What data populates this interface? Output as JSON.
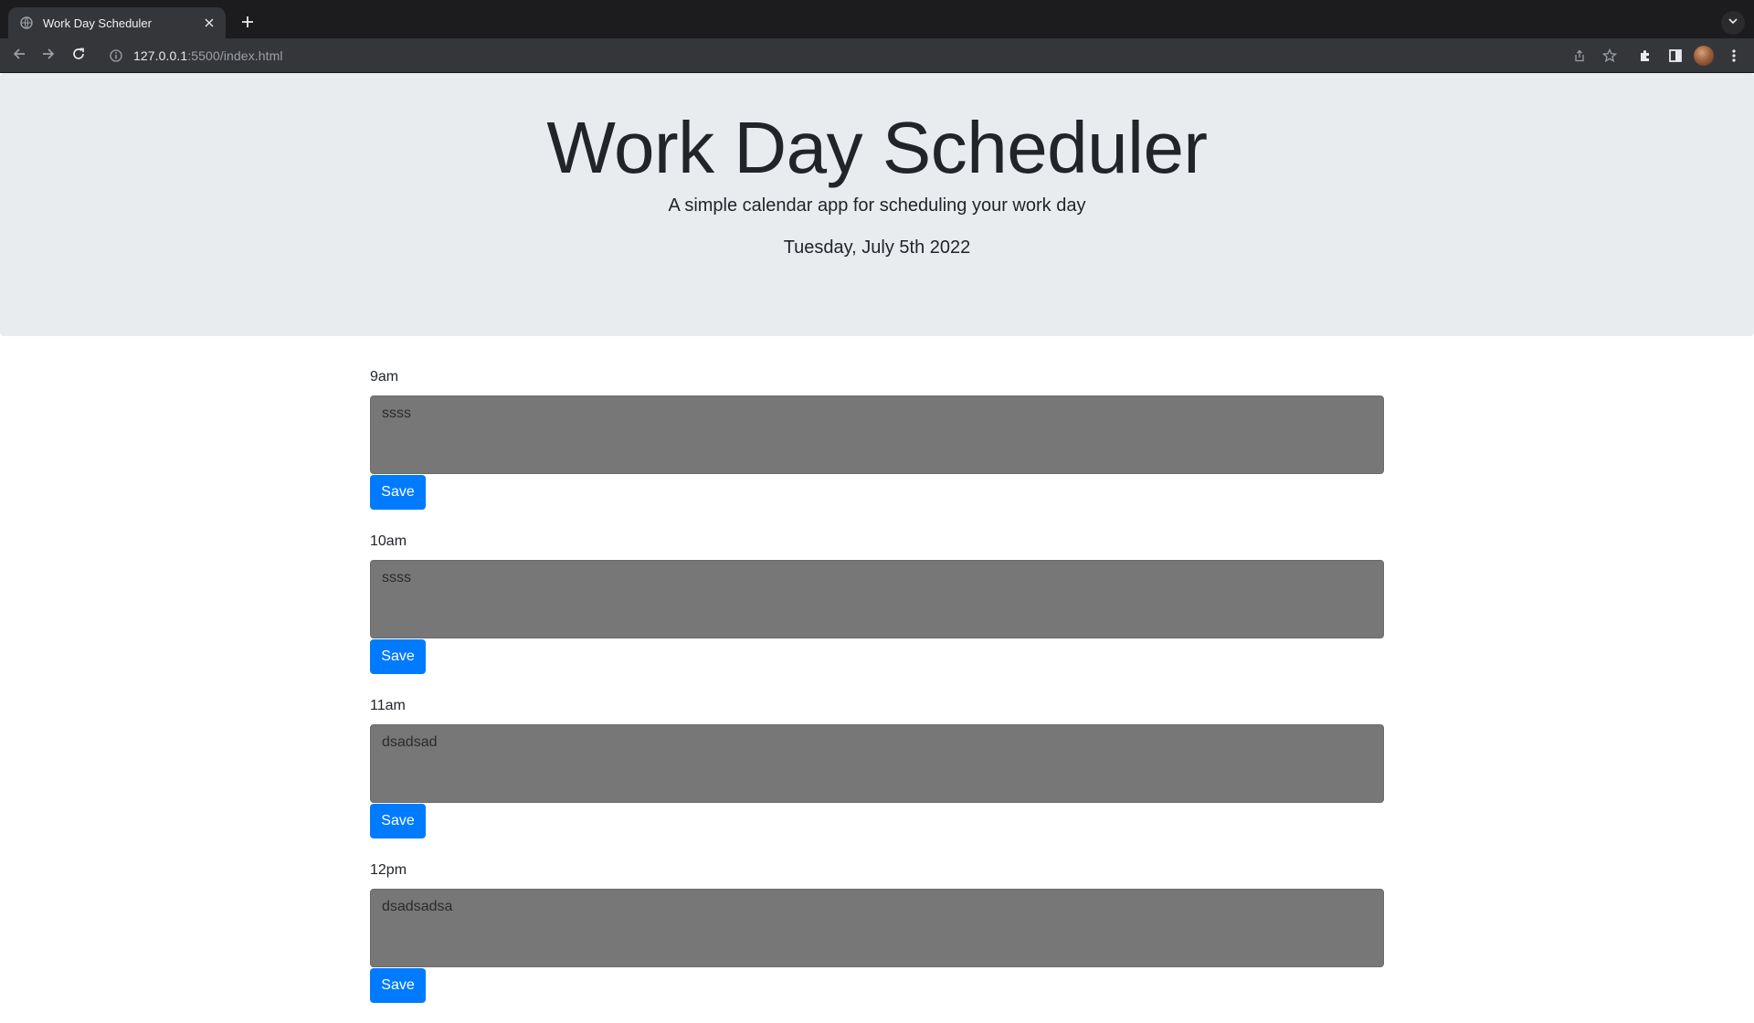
{
  "browser": {
    "tab_title": "Work Day Scheduler",
    "url_host": "127.0.0.1",
    "url_rest": ":5500/index.html"
  },
  "header": {
    "title": "Work Day Scheduler",
    "subtitle": "A simple calendar app for scheduling your work day",
    "date": "Tuesday, July 5th 2022"
  },
  "colors": {
    "jumbotron_bg": "#e9ecef",
    "textarea_bg": "#777777",
    "save_button": "#007bff"
  },
  "schedule": {
    "blocks": [
      {
        "hour": "9am",
        "text": "ssss",
        "save_label": "Save"
      },
      {
        "hour": "10am",
        "text": "ssss",
        "save_label": "Save"
      },
      {
        "hour": "11am",
        "text": "dsadsad",
        "save_label": "Save"
      },
      {
        "hour": "12pm",
        "text": "dsadsadsa",
        "save_label": "Save"
      }
    ]
  }
}
